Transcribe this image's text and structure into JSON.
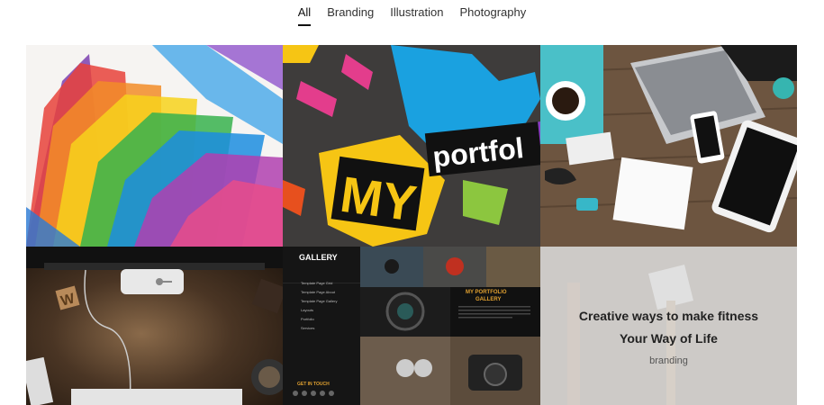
{
  "filters": [
    {
      "label": "All",
      "active": true
    },
    {
      "label": "Branding",
      "active": false
    },
    {
      "label": "Illustration",
      "active": false
    },
    {
      "label": "Photography",
      "active": false
    }
  ],
  "tiles": {
    "portfolio_sign": {
      "word1": "MY",
      "word2": "portfol"
    },
    "gallery": {
      "brand": "GALLERY",
      "menu": [
        "Template Page Grid",
        "Template Page About",
        "Template Page Gallery",
        "Layouts",
        "Portfolio",
        "Services"
      ],
      "heading_line1": "MY PORTFOLIO",
      "heading_line2": "GALLERY",
      "get_in_touch": "GET IN TOUCH"
    },
    "featured": {
      "title_line1": "Creative ways to make fitness",
      "title_line2": "Your Way of Life",
      "category": "branding"
    }
  }
}
